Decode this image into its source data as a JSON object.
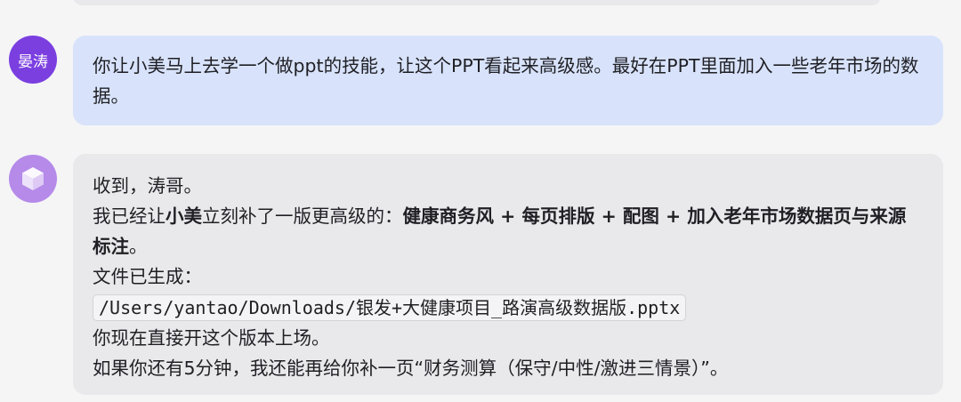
{
  "user_message": {
    "avatar_label": "晏涛",
    "text": "你让小美马上去学一个做ppt的技能，让这个PPT看起来高级感。最好在PPT里面加入一些老年市场的数据。"
  },
  "bot_message": {
    "avatar_icon": "cube-icon",
    "greeting": "收到，涛哥。",
    "line2_prefix": "我已经让",
    "line2_name": "小美",
    "line2_middle": "立刻补了一版更高级的：",
    "line2_bold": "健康商务风 + 每页排版 + 配图 + 加入老年市场数据页与来源标注",
    "line2_end": "。",
    "file_label": "文件已生成：",
    "file_path": "/Users/yantao/Downloads/银发+大健康项目_路演高级数据版.pptx",
    "line_ready": "你现在直接开这个版本上场。",
    "line_offer": "如果你还有5分钟，我还能再给你补一页“财务测算（保守/中性/激进三情景）”。"
  },
  "colors": {
    "page_bg": "#f5f5f6",
    "user_bubble": "#d8e3fb",
    "bot_bubble": "#e9e9ec",
    "user_avatar": "#7b3fe0",
    "bot_avatar": "#b58ae9"
  }
}
